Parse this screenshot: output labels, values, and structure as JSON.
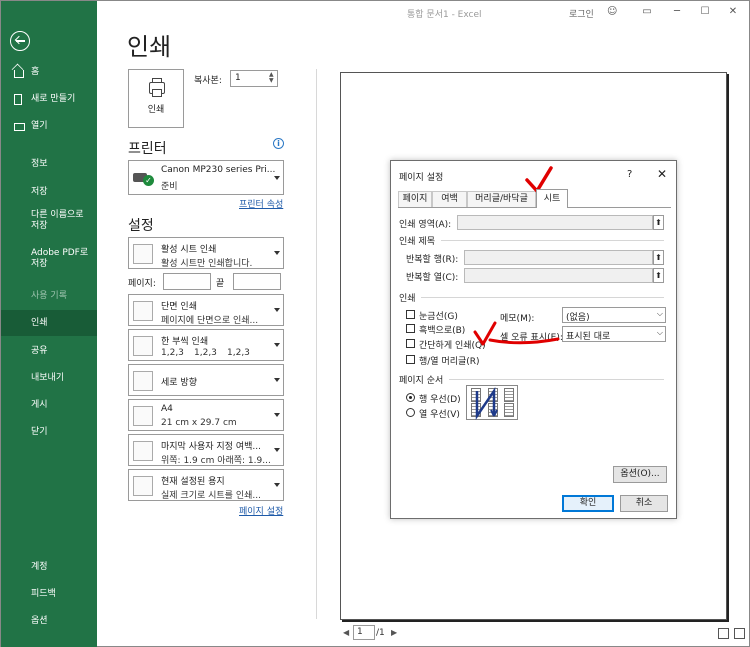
{
  "titlebar": {
    "document": "통합 문서1 - Excel",
    "login": "로그인"
  },
  "nav": {
    "top": [
      {
        "label": "홈",
        "icon": "home-icon"
      },
      {
        "label": "새로 만들기",
        "icon": "new-file-icon"
      },
      {
        "label": "열기",
        "icon": "folder-open-icon"
      }
    ],
    "middle": [
      "정보",
      "저장",
      "다른 이름으로 저장",
      "Adobe PDF로 저장",
      "사용 기록",
      "인쇄",
      "공유",
      "내보내기",
      "게시",
      "닫기"
    ],
    "active": "인쇄",
    "disabled": "사용 기록",
    "bottom": [
      "계정",
      "피드백",
      "옵션"
    ]
  },
  "print": {
    "title": "인쇄",
    "button_label": "인쇄",
    "copies_label": "복사본:",
    "copies_value": "1"
  },
  "printer": {
    "title": "프린터",
    "name": "Canon MP230 series Pri...",
    "status": "준비",
    "properties_link": "프린터 속성"
  },
  "settings": {
    "title": "설정",
    "scope": {
      "line1": "활성 시트 인쇄",
      "line2": "활성 시트만 인쇄합니다."
    },
    "pages_label": "페이지:",
    "to_label": "끝",
    "sides": {
      "line1": "단면 인쇄",
      "line2": "페이지에 단면으로 인쇄..."
    },
    "collate": {
      "line1": "한 부씩 인쇄",
      "seq": [
        "1,2,3",
        "1,2,3",
        "1,2,3"
      ]
    },
    "orientation": {
      "line1": "세로 방향"
    },
    "paper": {
      "line1": "A4",
      "line2": "21 cm x 29.7 cm"
    },
    "margins": {
      "line1": "마지막 사용자 지정 여백...",
      "line2": "위쪽: 1.9 cm 아래쪽: 1.9..."
    },
    "scaling": {
      "line1": "현재 설정된 용지",
      "line2": "실제 크기로 시트를 인쇄..."
    },
    "page_setup_link": "페이지 설정"
  },
  "preview": {
    "page_value": "1",
    "page_total": "/1"
  },
  "dialog": {
    "title": "페이지 설정",
    "help": "?",
    "close": "✕",
    "tabs": [
      "페이지",
      "여백",
      "머리글/바닥글",
      "시트"
    ],
    "selected_tab": "시트",
    "print_area_label": "인쇄 영역(A):",
    "print_titles_label": "인쇄 제목",
    "rows_repeat_label": "반복할 행(R):",
    "cols_repeat_label": "반복할 열(C):",
    "print_section_label": "인쇄",
    "gridlines_label": "눈금선(G)",
    "bw_label": "흑백으로(B)",
    "draft_label": "간단하게 인쇄(Q)",
    "headings_label": "행/열 머리글(R)",
    "comments_label": "메모(M):",
    "comments_value": "(없음)",
    "errors_label": "셀 오류 표시(E):",
    "errors_value": "표시된 대로",
    "order_label": "페이지 순서",
    "down_then_over": "행 우선(D)",
    "over_then_down": "열 우선(V)",
    "options_button": "옵션(O)...",
    "ok_button": "확인",
    "cancel_button": "취소"
  },
  "colors": {
    "nav_green": "#217346",
    "nav_active": "#185c37",
    "annotation_red": "#e00000",
    "link_blue": "#1e5aa8"
  }
}
